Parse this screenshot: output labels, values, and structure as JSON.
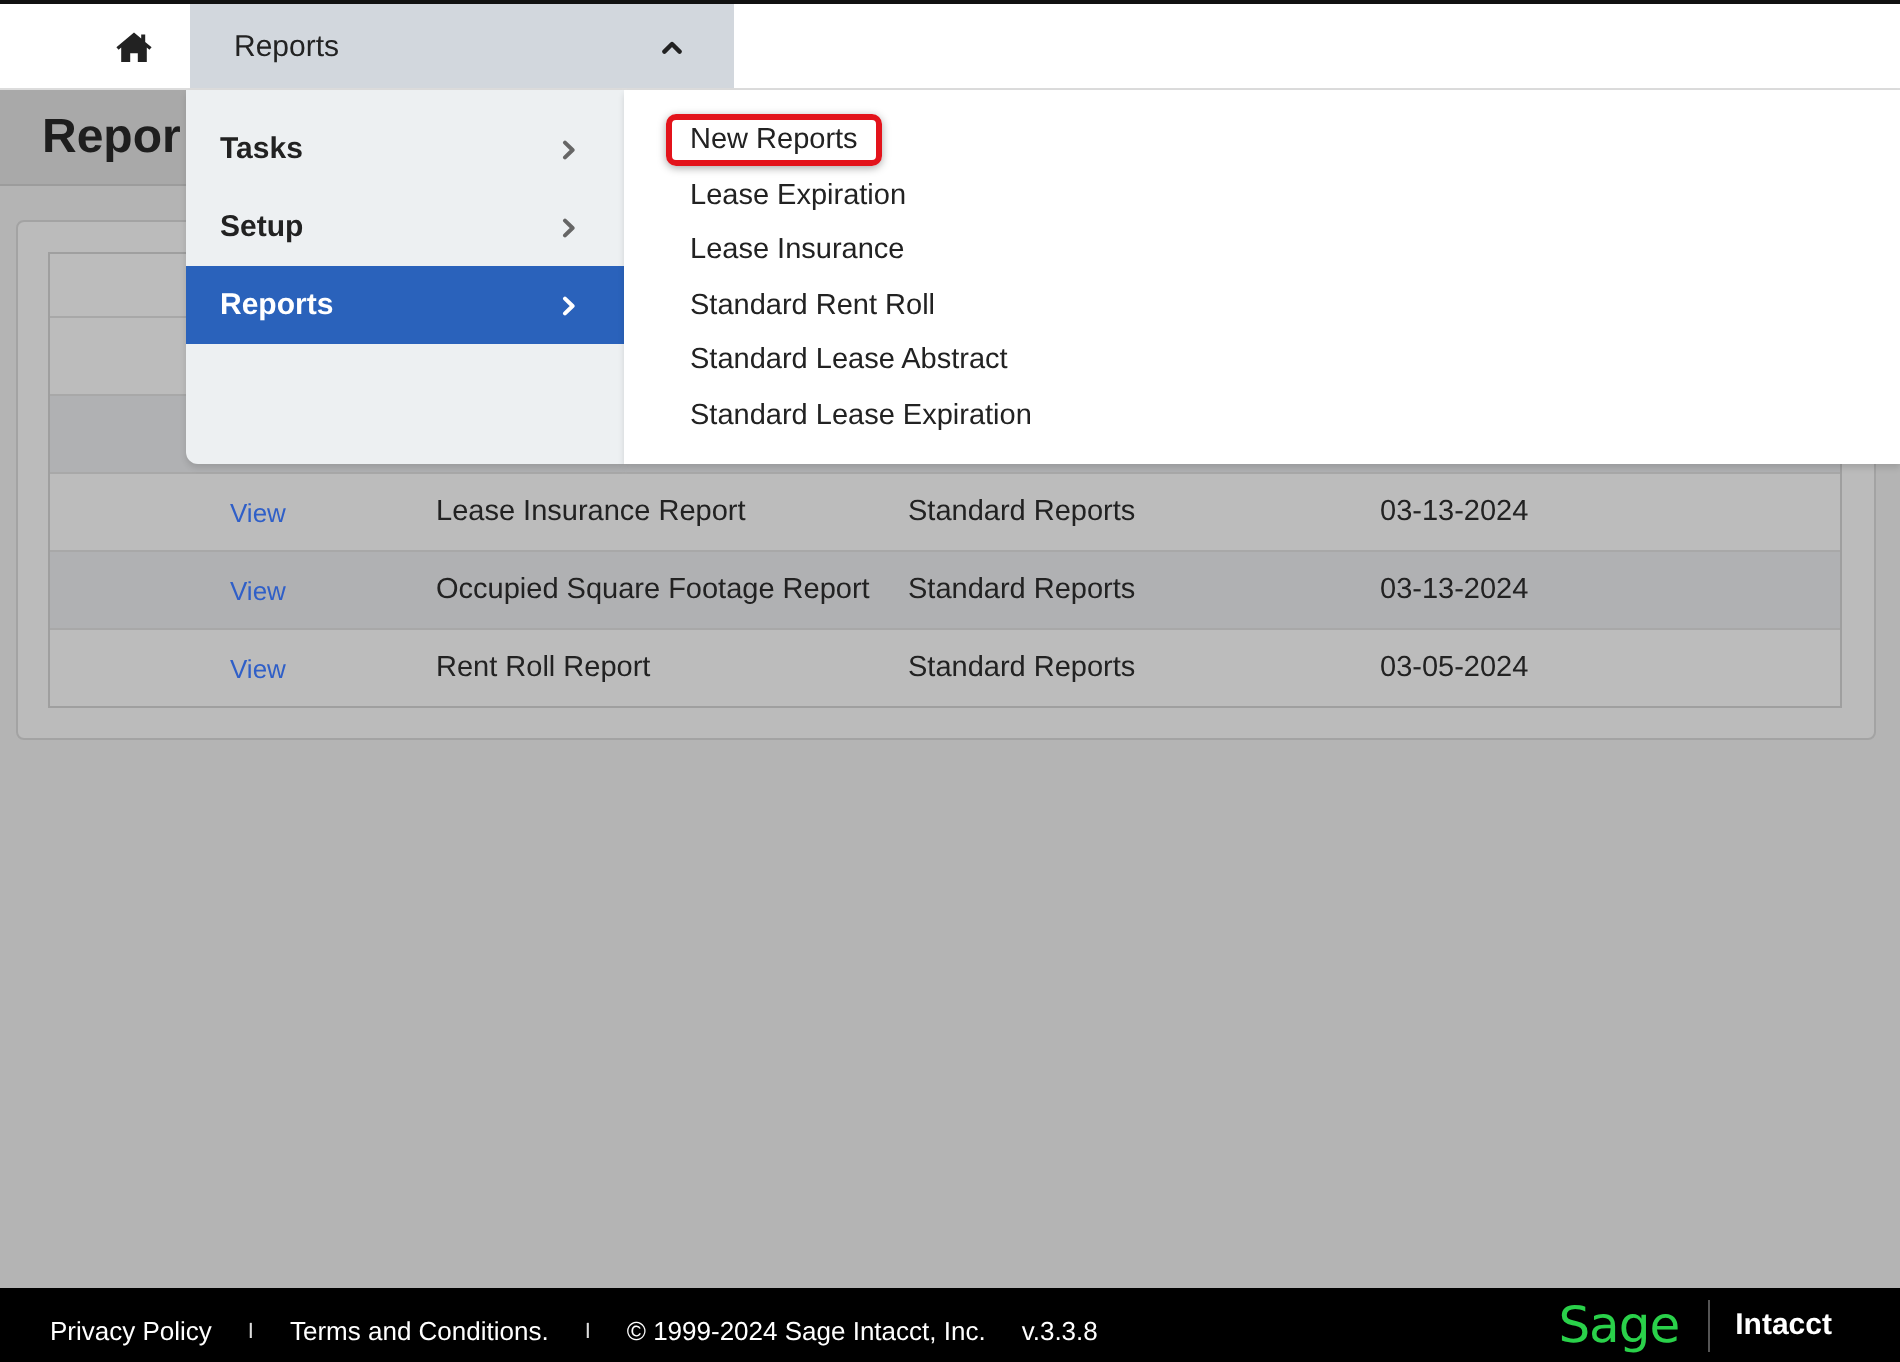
{
  "top_nav": {
    "tab": {
      "label": "Reports",
      "expanded": true
    }
  },
  "page": {
    "title": "Repor"
  },
  "table": {
    "rows": [
      {
        "kind": "header",
        "shaded": false
      },
      {
        "kind": "blank",
        "shaded": false
      },
      {
        "kind": "blank",
        "shaded": true
      },
      {
        "kind": "data",
        "shaded": false,
        "link": "View",
        "name": "Lease Insurance Report",
        "category": "Standard Reports",
        "date": "03-13-2024"
      },
      {
        "kind": "data",
        "shaded": true,
        "link": "View",
        "name": "Occupied Square Footage Report",
        "category": "Standard Reports",
        "date": "03-13-2024"
      },
      {
        "kind": "data",
        "shaded": false,
        "link": "View",
        "name": "Rent Roll Report",
        "category": "Standard Reports",
        "date": "03-05-2024"
      }
    ]
  },
  "menu": {
    "items": [
      {
        "label": "Tasks",
        "selected": false
      },
      {
        "label": "Setup",
        "selected": false
      },
      {
        "label": "Reports",
        "selected": true
      }
    ],
    "submenu": [
      {
        "label": "New Reports",
        "highlighted": true
      },
      {
        "label": "Lease Expiration",
        "highlighted": false
      },
      {
        "label": "Lease Insurance",
        "highlighted": false
      },
      {
        "label": "Standard Rent Roll",
        "highlighted": false
      },
      {
        "label": "Standard Lease Abstract",
        "highlighted": false
      },
      {
        "label": "Standard Lease Expiration",
        "highlighted": false
      }
    ]
  },
  "footer": {
    "items": [
      {
        "kind": "link",
        "text": "Privacy Policy"
      },
      {
        "kind": "separator",
        "text": "I"
      },
      {
        "kind": "link",
        "text": "Terms and Conditions."
      },
      {
        "kind": "separator",
        "text": "I"
      },
      {
        "kind": "text",
        "text": "© 1999-2024 Sage Intacct, Inc."
      },
      {
        "kind": "text",
        "text": "v.3.3.8"
      }
    ],
    "logo": {
      "brand": "Sage",
      "product": "Intacct"
    }
  }
}
